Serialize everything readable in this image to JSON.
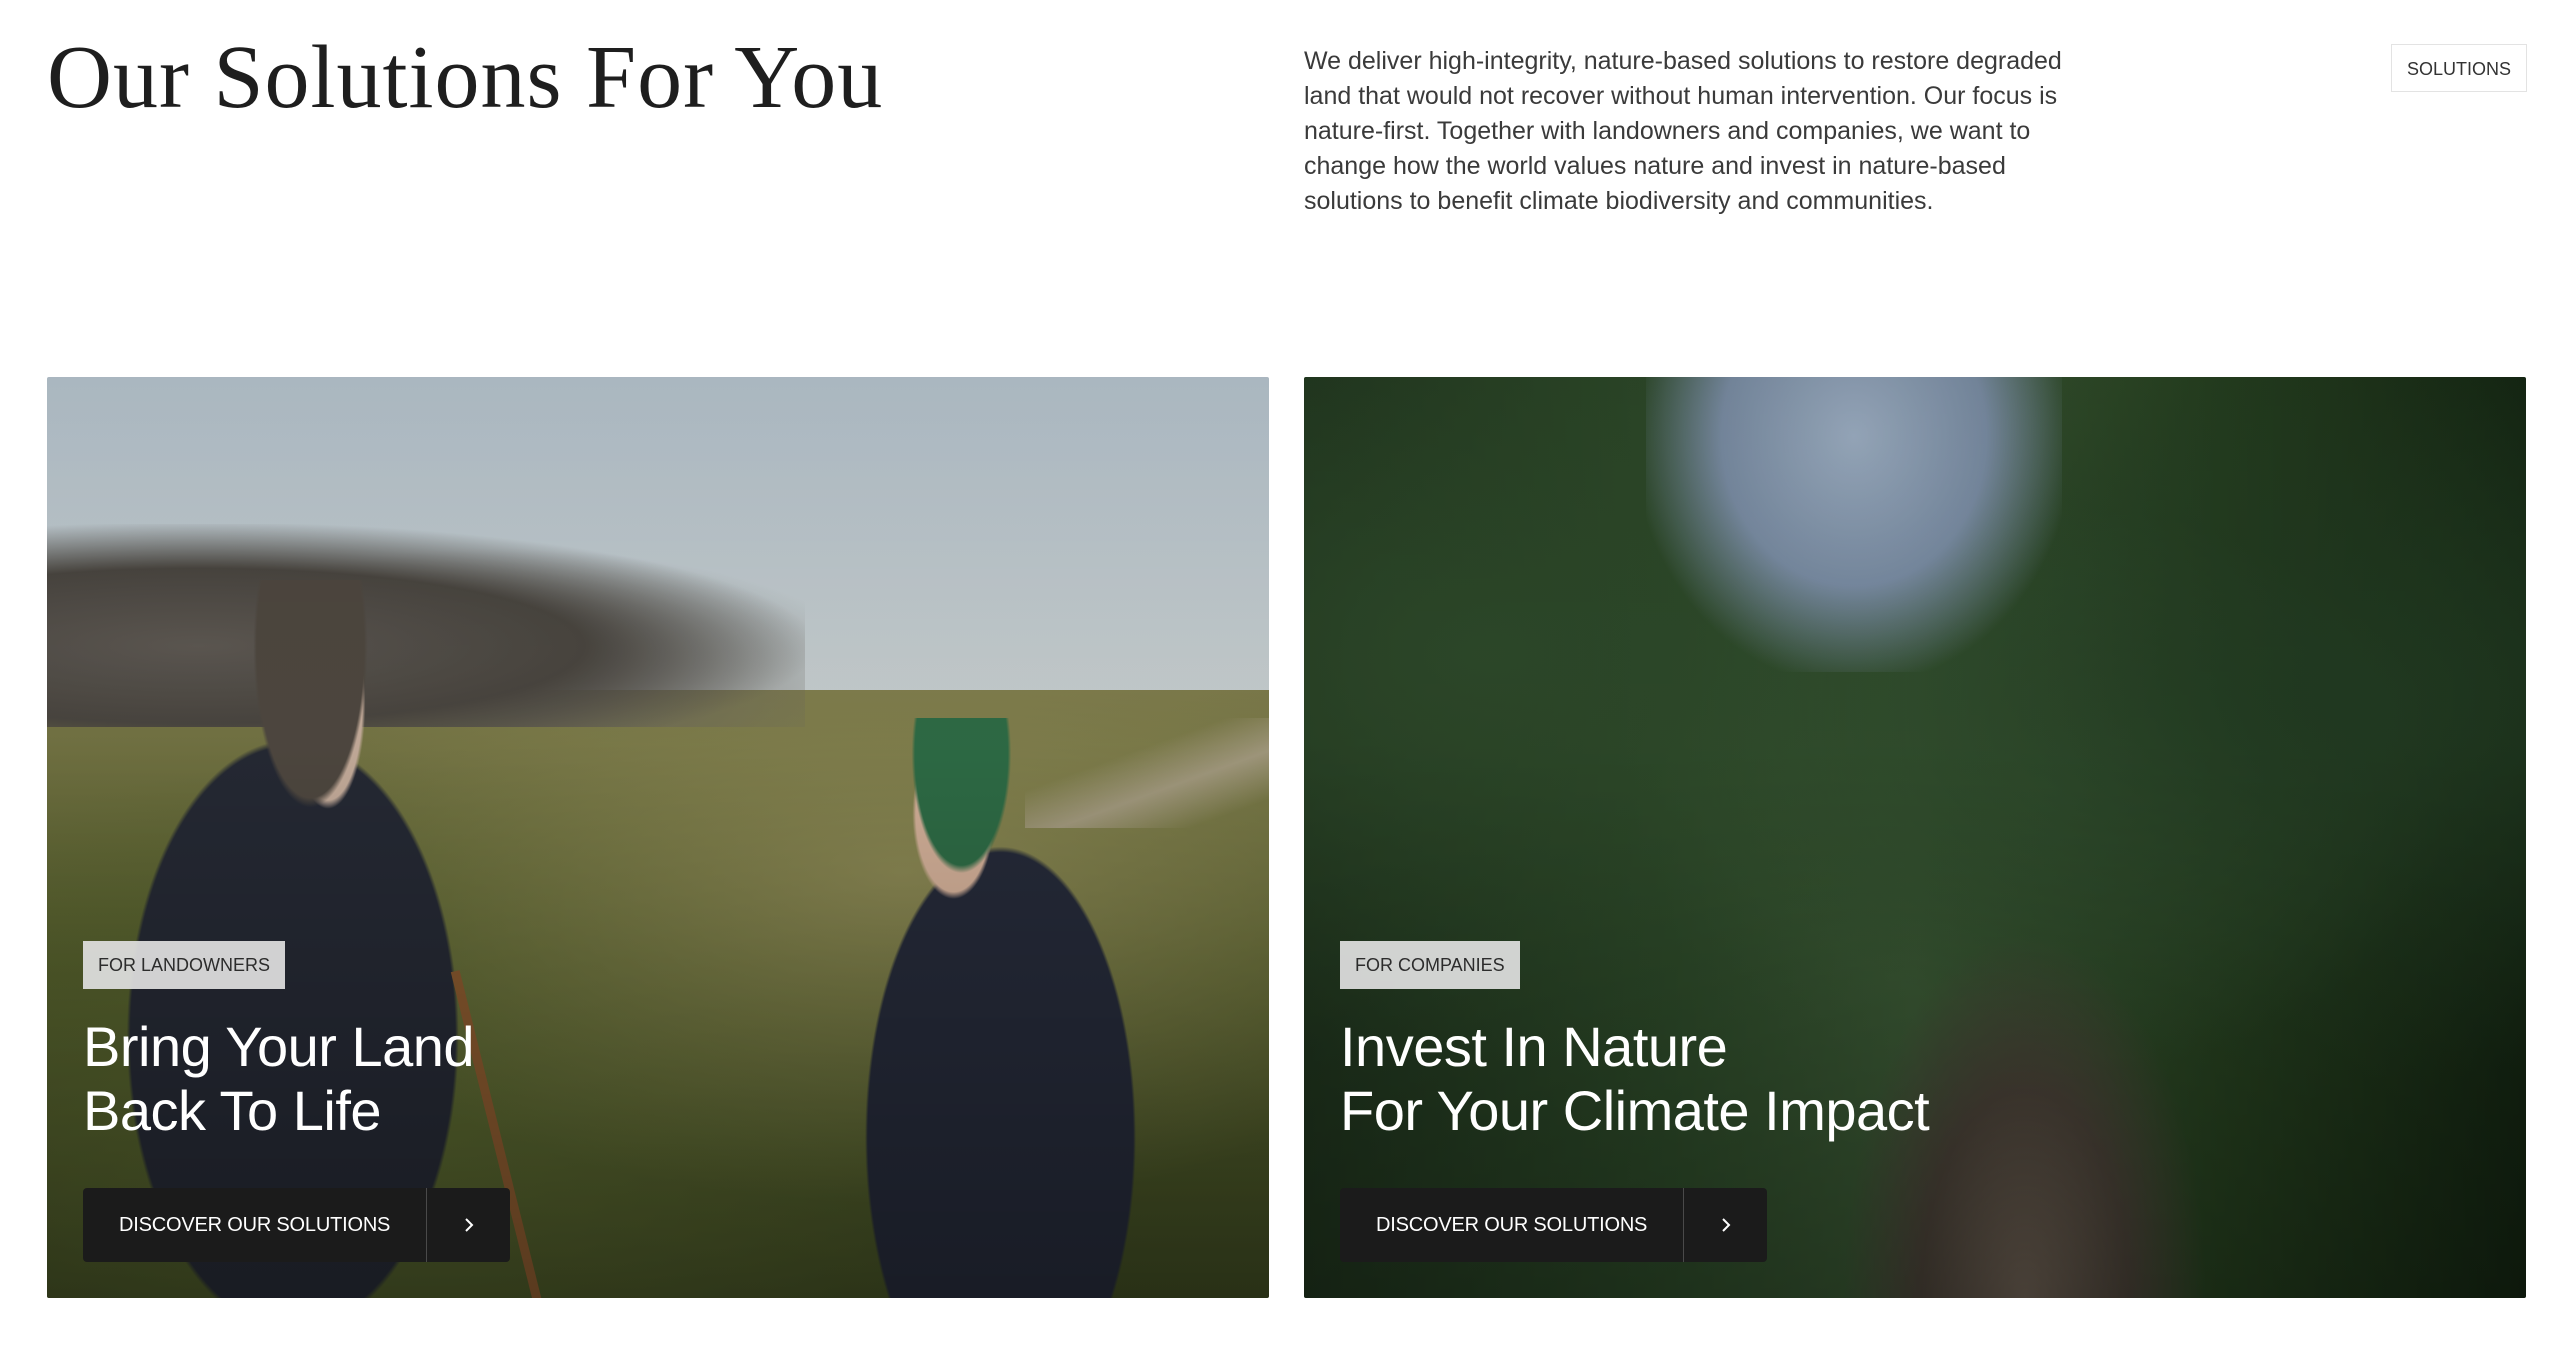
{
  "header": {
    "title": "Our Solutions For You",
    "description": "We deliver high-integrity, nature-based solutions to restore degraded land that would not recover without human intervention. Our focus is nature-first. Together with landowners and companies, we want to change how the world values nature and invest in nature-based solutions to benefit climate biodiversity and communities.",
    "section_badge": "SOLUTIONS"
  },
  "cards": [
    {
      "tag": "FOR LANDOWNERS",
      "heading_line1": "Bring Your Land",
      "heading_line2": "Back To Life",
      "button_label": "DISCOVER OUR SOLUTIONS",
      "button_icon": "chevron-right-icon"
    },
    {
      "tag": "FOR COMPANIES",
      "heading_line1": "Invest In Nature",
      "heading_line2": "For Your Climate Impact",
      "button_label": "DISCOVER OUR SOLUTIONS",
      "button_icon": "chevron-right-icon"
    }
  ],
  "colors": {
    "button_bg": "#1b1b1b",
    "tag_bg": "#e1e1e1",
    "heading_text": "#ffffff",
    "body_text": "#3a3a3a"
  }
}
